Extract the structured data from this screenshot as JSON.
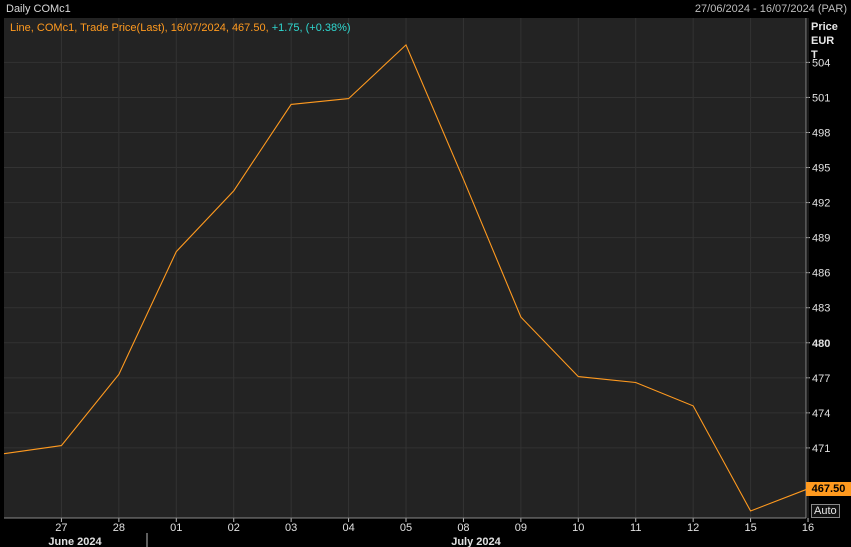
{
  "header": {
    "title": "Daily COMc1",
    "range": "27/06/2024 - 16/07/2024 (PAR)"
  },
  "legend": {
    "main": "Line, COMc1, Trade Price(Last), 16/07/2024, 467.50, ",
    "change": "+1.75, (+0.38%)"
  },
  "axis": {
    "price_header": [
      "Price",
      "EUR",
      "T"
    ],
    "auto_label": "Auto",
    "last_value_label": "467.50"
  },
  "colors": {
    "line": "#ff9a1f",
    "change": "#2fd8d0",
    "background": "#232323",
    "grid": "#333333"
  },
  "chart_data": {
    "type": "line",
    "series": [
      {
        "values": [
          470.5,
          471.2,
          477.3,
          487.8,
          493.0,
          500.4,
          500.9,
          505.5,
          494.0,
          482.2,
          477.1,
          476.6,
          474.6,
          465.6,
          467.5
        ]
      }
    ],
    "x_ticks": [
      "27",
      "28",
      "01",
      "02",
      "03",
      "04",
      "05",
      "08",
      "09",
      "10",
      "11",
      "12",
      "15",
      "16"
    ],
    "month_labels": [
      "June 2024",
      "July 2024"
    ],
    "y_ticks": [
      471,
      474,
      477,
      480,
      483,
      486,
      489,
      492,
      495,
      498,
      501,
      504
    ],
    "ylim": [
      465.0,
      507.8
    ],
    "grid": true,
    "y_axis_position": "right"
  }
}
